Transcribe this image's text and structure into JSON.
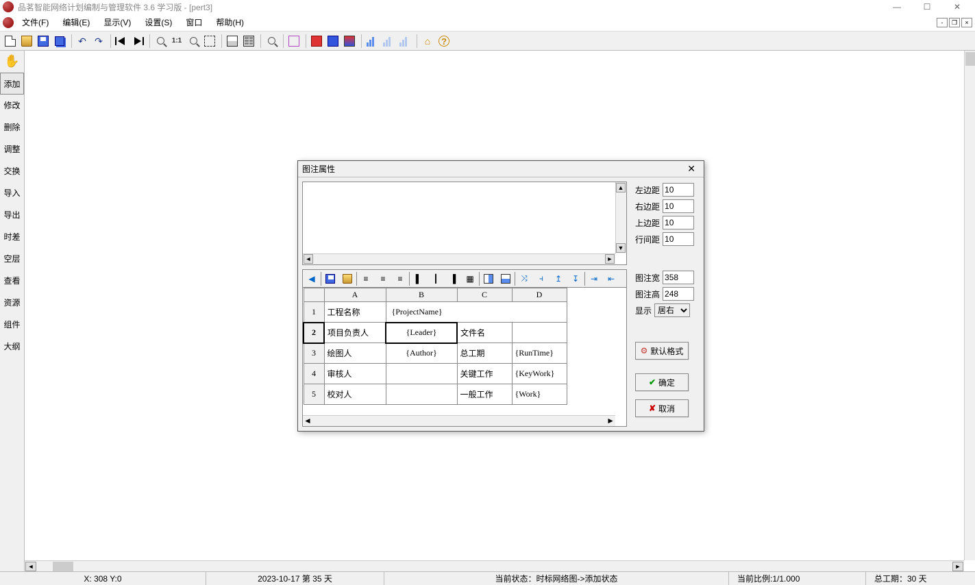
{
  "app": {
    "title": "品茗智能网络计划编制与管理软件 3.6 学习版 - [pert3]"
  },
  "menu": {
    "file": "文件(F)",
    "edit": "编辑(E)",
    "view": "显示(V)",
    "settings": "设置(S)",
    "window": "窗口",
    "help": "帮助(H)"
  },
  "leftTools": {
    "add": "添加",
    "modify": "修改",
    "delete": "删除",
    "adjust": "调整",
    "swap": "交换",
    "import": "导入",
    "export": "导出",
    "slack": "时差",
    "empty": "空层",
    "view": "查看",
    "resource": "资源",
    "component": "组件",
    "outline": "大纲"
  },
  "dialog": {
    "title": "图注属性",
    "leftMargin": {
      "label": "左边距",
      "value": "10"
    },
    "rightMargin": {
      "label": "右边距",
      "value": "10"
    },
    "topMargin": {
      "label": "上边距",
      "value": "10"
    },
    "lineSpacing": {
      "label": "行间距",
      "value": "10"
    },
    "width": {
      "label": "图注宽",
      "value": "358"
    },
    "height": {
      "label": "图注高",
      "value": "248"
    },
    "display": {
      "label": "显示",
      "value": "居右"
    },
    "defaultFormat": "默认格式",
    "ok": "确定",
    "cancel": "取消",
    "cols": {
      "a": "A",
      "b": "B",
      "c": "C",
      "d": "D"
    },
    "rows": [
      {
        "n": "1",
        "a": "工程名称",
        "b": "{ProjectName}",
        "c": "",
        "d": ""
      },
      {
        "n": "2",
        "a": "项目负责人",
        "b": "{Leader}",
        "c": "文件名",
        "d": ""
      },
      {
        "n": "3",
        "a": "绘图人",
        "b": "{Author}",
        "c": "总工期",
        "d": "{RunTime}"
      },
      {
        "n": "4",
        "a": "审核人",
        "b": "",
        "c": "关键工作",
        "d": "{KeyWork}"
      },
      {
        "n": "5",
        "a": "校对人",
        "b": "",
        "c": "一般工作",
        "d": "{Work}"
      }
    ]
  },
  "statusbar": {
    "coords": "X: 308   Y:0",
    "date": "2023-10-17 第 35 天",
    "state": "当前状态：时标网络图->添加状态",
    "scale": "当前比例:1/1.000",
    "duration": "总工期：30 天"
  }
}
